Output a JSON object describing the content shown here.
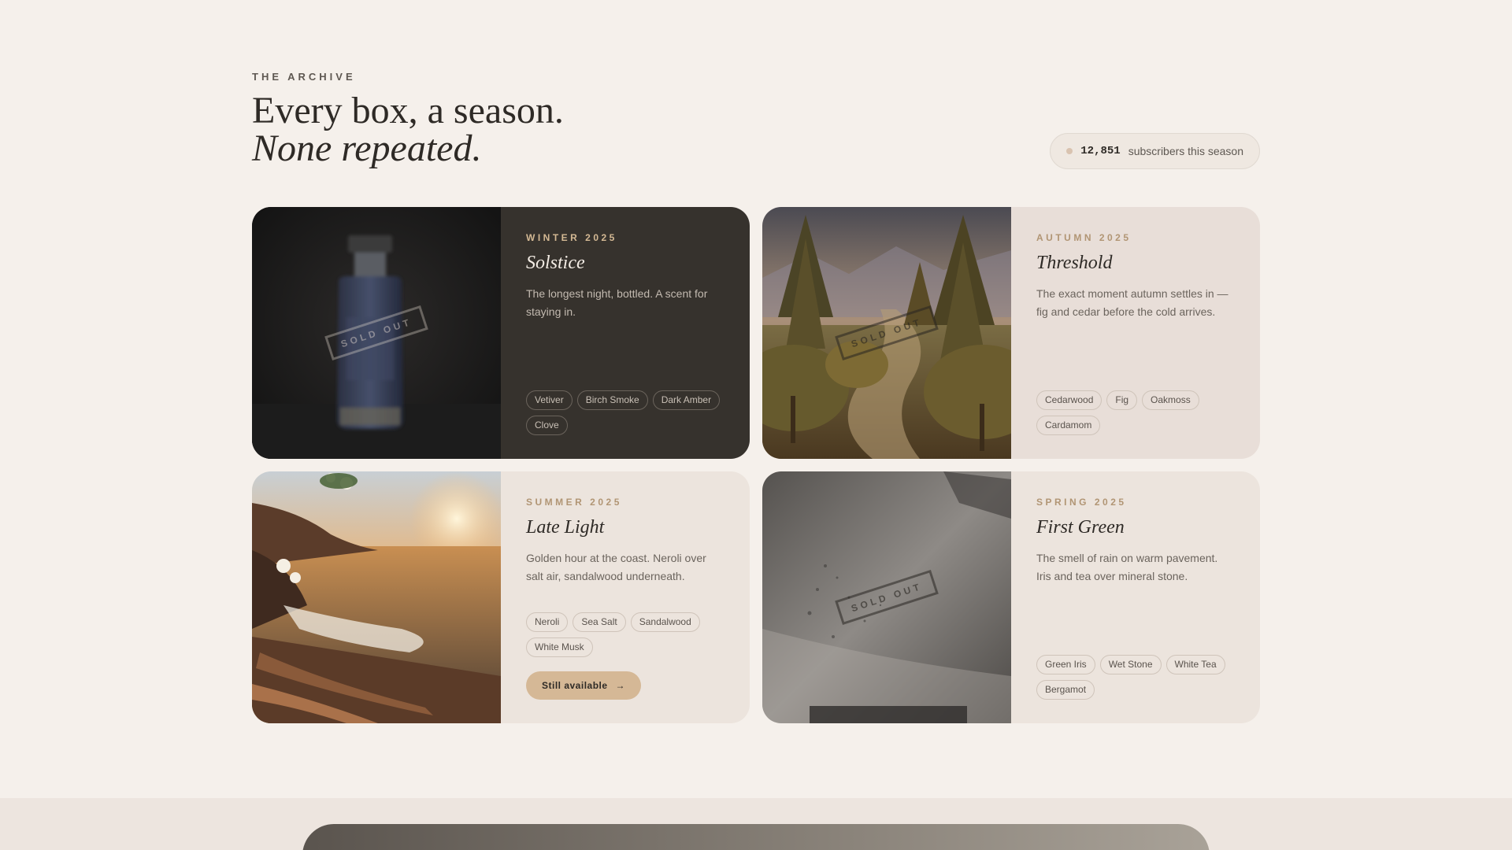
{
  "header": {
    "eyebrow": "THE ARCHIVE",
    "title_line1": "Every box, a season.",
    "title_line2": "None repeated."
  },
  "subscribers": {
    "count": "12,851",
    "label": "subscribers this season"
  },
  "cards": [
    {
      "season": "WINTER 2025",
      "name": "Solstice",
      "description": "The longest night, bottled. A scent for staying in.",
      "stamp": "SOLD OUT",
      "tags": [
        "Vetiver",
        "Birch Smoke",
        "Dark Amber",
        "Clove"
      ]
    },
    {
      "season": "AUTUMN 2025",
      "name": "Threshold",
      "description": "The exact moment autumn settles in — fig and cedar before the cold arrives.",
      "stamp": "SOLD OUT",
      "tags": [
        "Cedarwood",
        "Fig",
        "Oakmoss",
        "Cardamom"
      ]
    },
    {
      "season": "SUMMER 2025",
      "name": "Late Light",
      "description": "Golden hour at the coast. Neroli over salt air, sandalwood underneath.",
      "tags": [
        "Neroli",
        "Sea Salt",
        "Sandalwood",
        "White Musk"
      ],
      "cta": "Still available",
      "cta_icon": "→"
    },
    {
      "season": "SPRING 2025",
      "name": "First Green",
      "description": "The smell of rain on warm pavement. Iris and tea over mineral stone.",
      "stamp": "SOLD OUT",
      "tags": [
        "Green Iris",
        "Wet Stone",
        "White Tea",
        "Bergamot"
      ]
    }
  ],
  "colors": {
    "background": "#f5f0eb",
    "dark_card": "#36322d",
    "accent": "#d5b896",
    "season_label": "#b19574"
  }
}
